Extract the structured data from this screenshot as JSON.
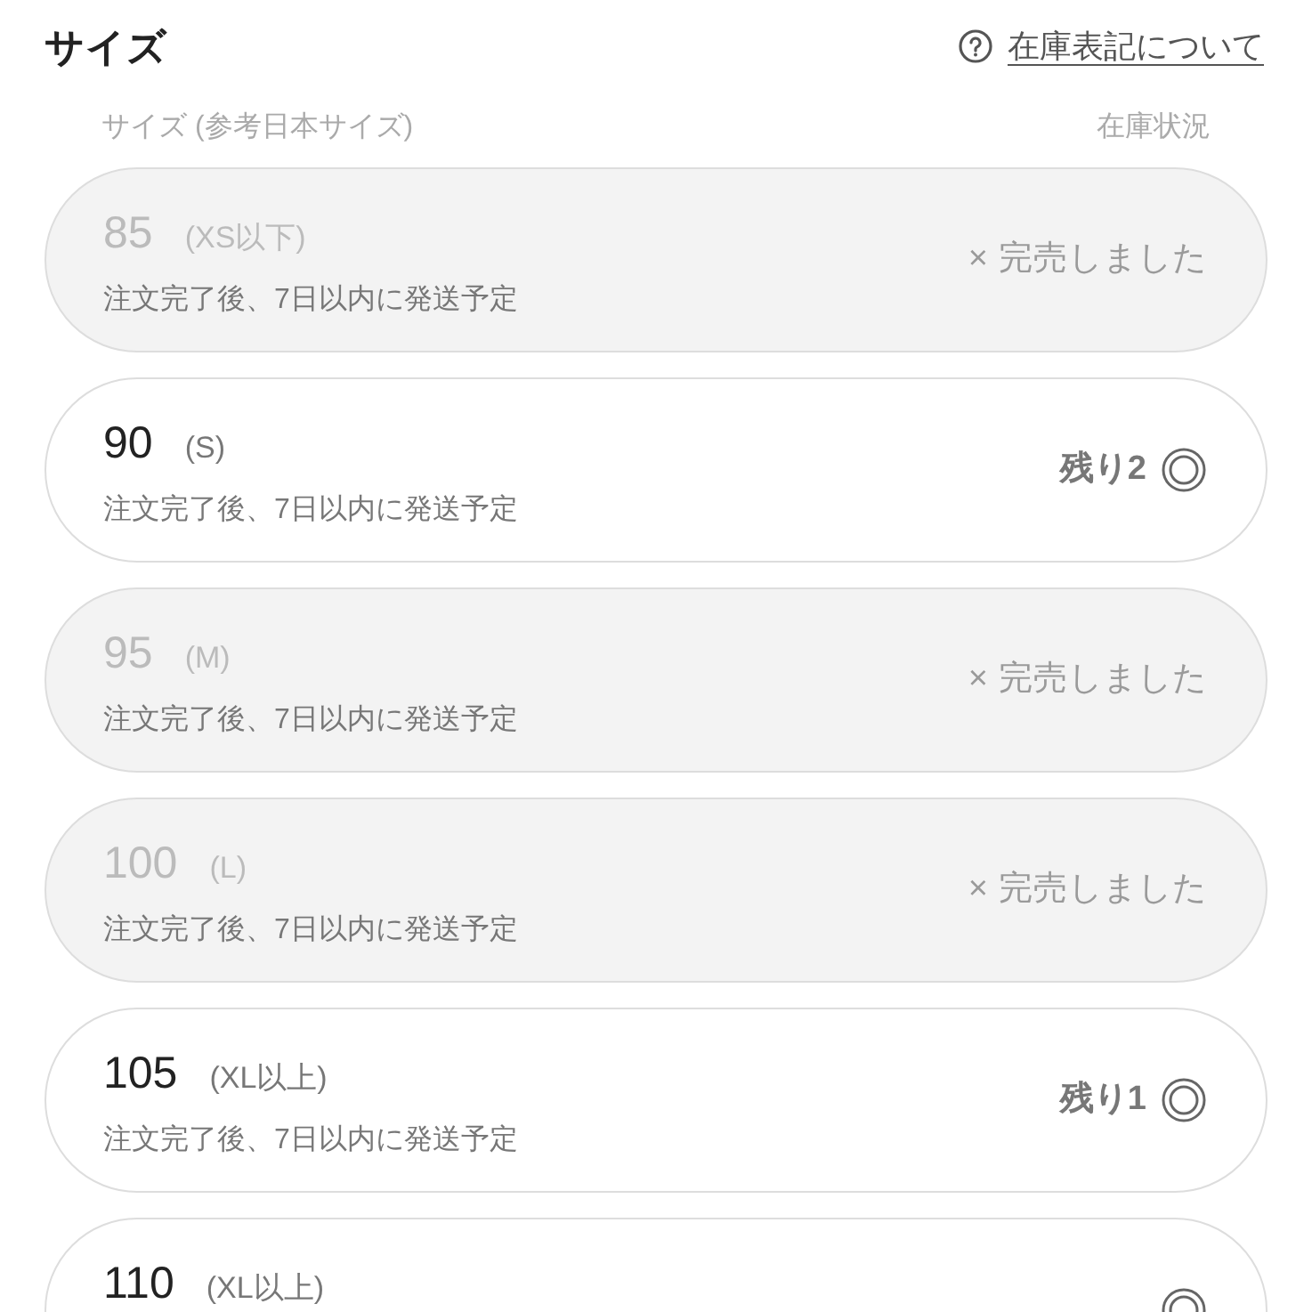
{
  "title": "サイズ",
  "help_link": {
    "label": "在庫表記について"
  },
  "columns": [
    "サイズ (参考日本サイズ)",
    "在庫状況"
  ],
  "sizes": [
    {
      "kind": "sold_out",
      "number": "85",
      "label": "(XS以下)",
      "shipping": "注文完了後、7日以内に発送予定",
      "stock": "× 完売しました"
    },
    {
      "kind": "available",
      "number": "90",
      "label": "(S)",
      "shipping": "注文完了後、7日以内に発送予定",
      "stock": "残り2"
    },
    {
      "kind": "sold_out",
      "number": "95",
      "label": "(M)",
      "shipping": "注文完了後、7日以内に発送予定",
      "stock": "× 完売しました"
    },
    {
      "kind": "sold_out",
      "number": "100",
      "label": "(L)",
      "shipping": "注文完了後、7日以内に発送予定",
      "stock": "× 完売しました"
    },
    {
      "kind": "available",
      "number": "105",
      "label": "(XL以上)",
      "shipping": "注文完了後、7日以内に発送予定",
      "stock": "残り1"
    },
    {
      "kind": "available",
      "number": "110",
      "label": "(XL以上)"
    }
  ]
}
